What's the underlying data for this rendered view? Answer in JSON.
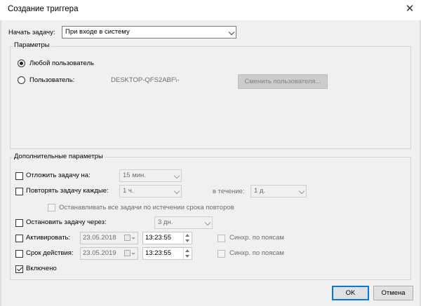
{
  "window": {
    "title": "Создание триггера",
    "close_glyph": "✕"
  },
  "start_task": {
    "label": "Начать задачу:",
    "value": "При входе в систему"
  },
  "params": {
    "group_label": "Параметры",
    "any_user_label": "Любой пользователь",
    "user_label": "Пользователь:",
    "user_value": "DESKTOP-QFS2ABF\\-",
    "change_user_button": "Сменить пользователя..."
  },
  "advanced": {
    "group_label": "Дополнительные параметры",
    "delay": {
      "label": "Отложить задачу на:",
      "value": "15 мин."
    },
    "repeat": {
      "label": "Повторять задачу каждые:",
      "value": "1 ч.",
      "duration_label": "в течение:",
      "duration_value": "1 д."
    },
    "stop_all": {
      "label": "Останавливать все задачи по истечении срока повторов"
    },
    "stop_after": {
      "label": "Остановить задачу через:",
      "value": "3 дн."
    },
    "activate": {
      "label": "Активировать:",
      "date": "23.05.2018",
      "time": "13:23:55",
      "sync_label": "Синхр. по поясам"
    },
    "expire": {
      "label": "Срок действия:",
      "date": "23.05.2019",
      "time": "13:23:55",
      "sync_label": "Синхр. по поясам"
    },
    "enabled": {
      "label": "Включено",
      "checked": true
    }
  },
  "buttons": {
    "ok": "OK",
    "cancel": "Отмена"
  }
}
